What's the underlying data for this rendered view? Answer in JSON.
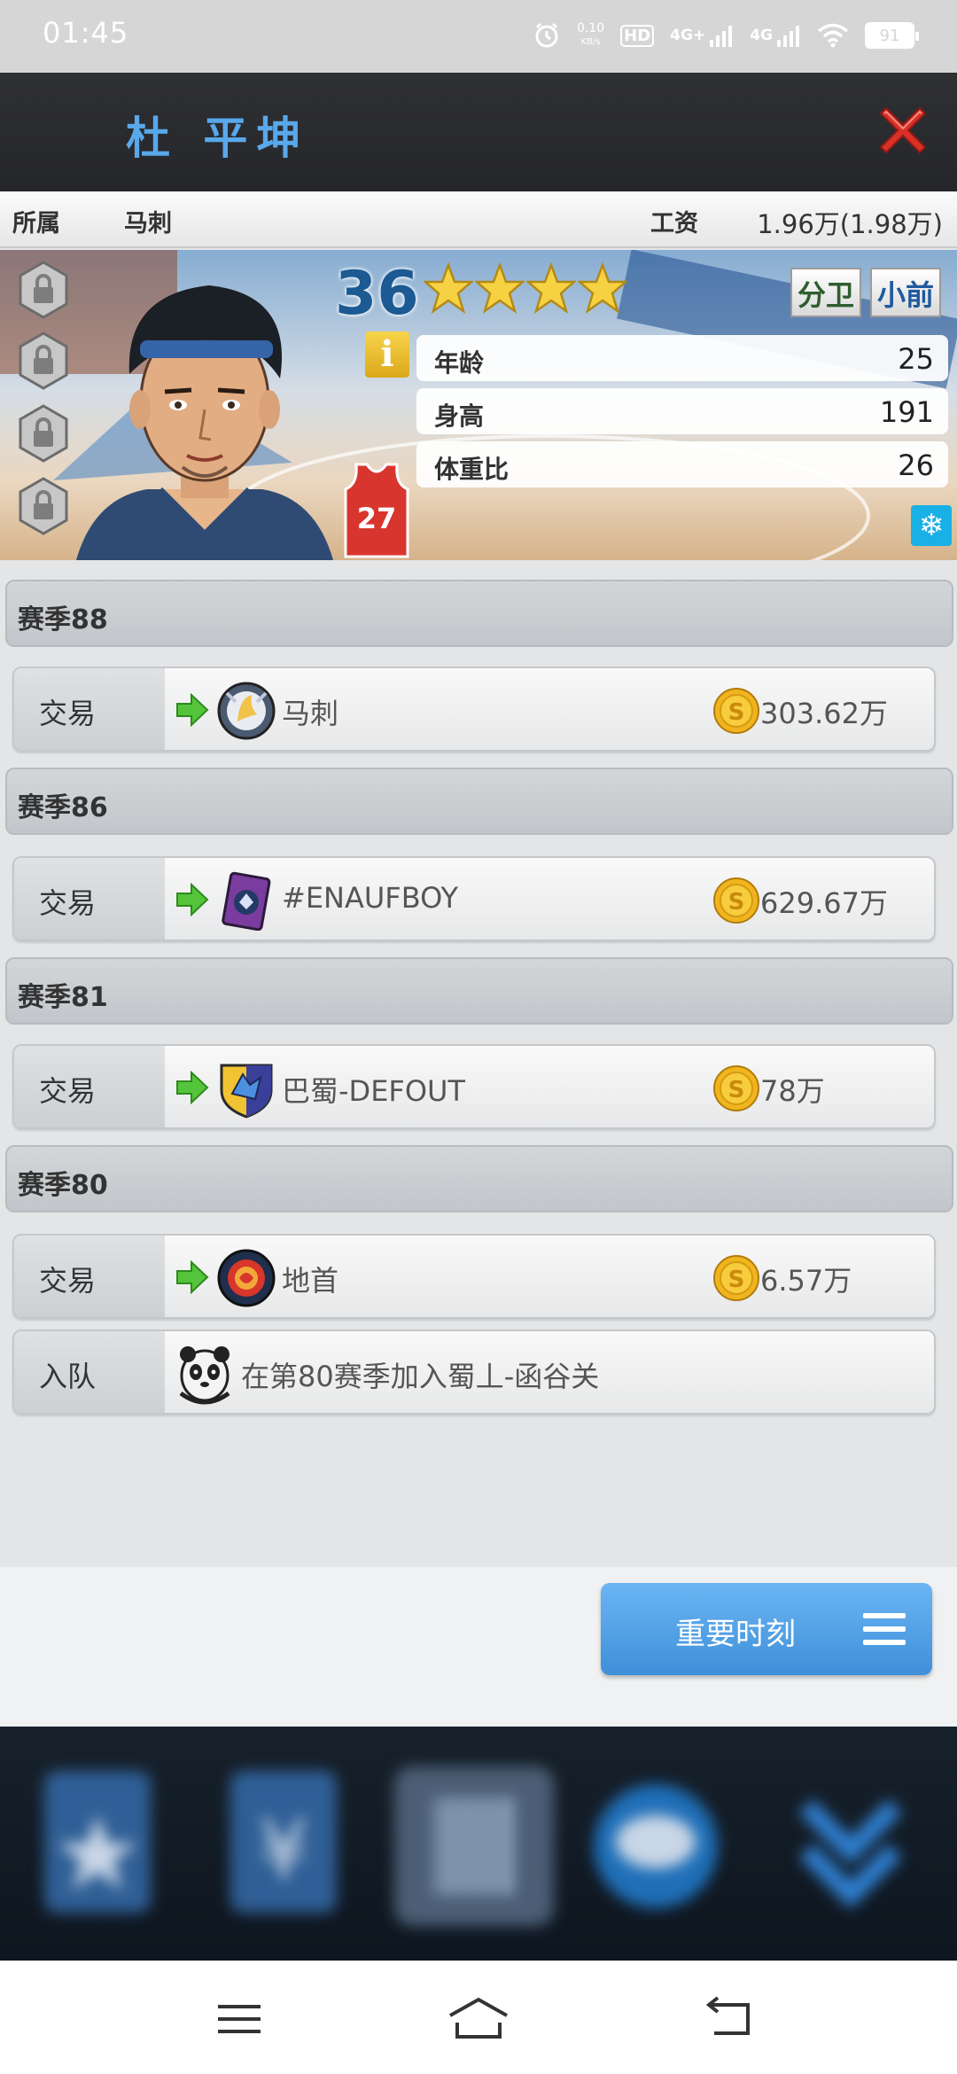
{
  "status_bar": {
    "time": "01:45",
    "net_speed": "0.10",
    "net_unit": "KB/s",
    "hd_label": "HD",
    "signal1": "4G+",
    "signal2": "4G",
    "battery": "91",
    "icons": [
      "alarm-icon",
      "hd-icon",
      "signal-icon",
      "signal-icon",
      "wifi-icon",
      "battery-icon"
    ]
  },
  "dialog": {
    "player_name": "杜 平坤",
    "close_icon": "close-icon"
  },
  "info_strip": {
    "team_label": "所属",
    "team_value": "马刺",
    "salary_label": "工资",
    "salary_value": "1.96万(1.98万)"
  },
  "player": {
    "rating": "36",
    "stars": 4,
    "positions": [
      "分卫",
      "小前"
    ],
    "jersey_number": "27",
    "info_icon": "i",
    "stats": [
      {
        "label": "年龄",
        "value": "25"
      },
      {
        "label": "身高",
        "value": "191"
      },
      {
        "label": "体重比",
        "value": "26"
      }
    ],
    "locked_slots": 4
  },
  "history": [
    {
      "season": "赛季88",
      "events": [
        {
          "type": "交易",
          "team": "马刺",
          "price": "303.62万",
          "logo": "spurs-logo"
        }
      ]
    },
    {
      "season": "赛季86",
      "events": [
        {
          "type": "交易",
          "team": "#ENAUFBOY",
          "price": "629.67万",
          "logo": "wolf-card-logo"
        }
      ]
    },
    {
      "season": "赛季81",
      "events": [
        {
          "type": "交易",
          "team": "巴蜀-DEFOUT",
          "price": "78万",
          "logo": "wolf-shield-logo"
        }
      ]
    },
    {
      "season": "赛季80",
      "events": [
        {
          "type": "交易",
          "team": "地首",
          "price": "6.57万",
          "logo": "round-emblem-logo"
        },
        {
          "type": "入队",
          "team": "在第80赛季加入蜀丄-函谷关",
          "logo": "panda-logo"
        }
      ]
    }
  ],
  "footer": {
    "moments_button": "重要时刻",
    "menu_icon": "menu-icon"
  },
  "colors": {
    "name_blue": "#58a8ea",
    "button_blue": "#4a9be3",
    "header_dark": "#2b2c30"
  }
}
